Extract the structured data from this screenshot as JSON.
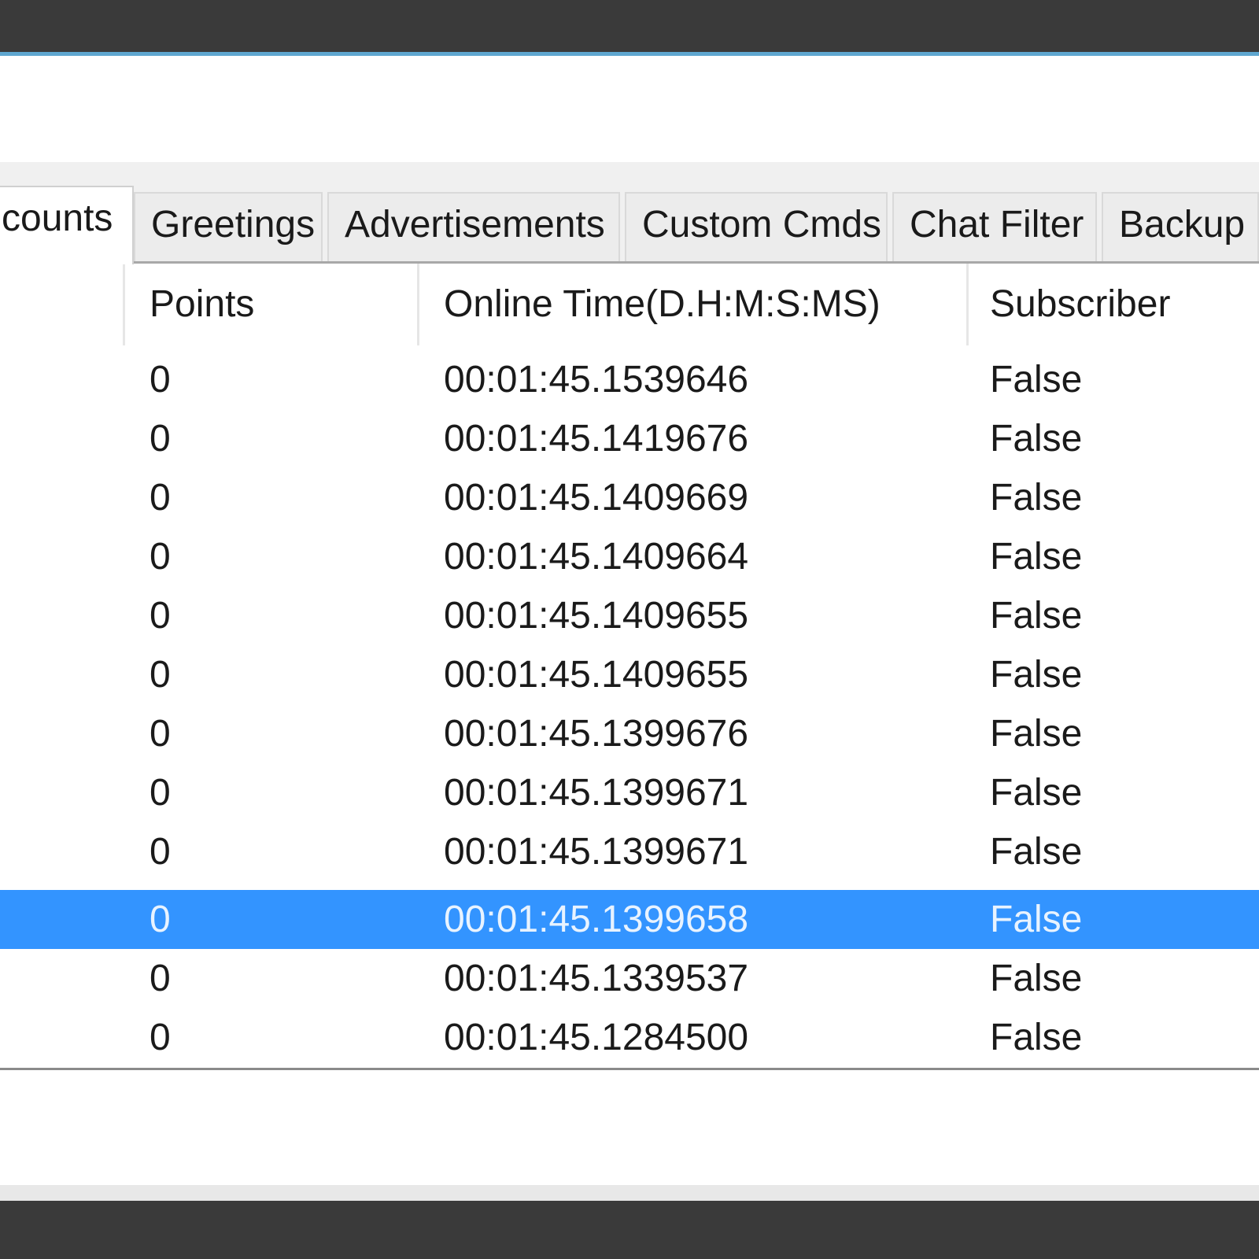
{
  "tabs": [
    {
      "label": "counts",
      "active": true
    },
    {
      "label": "Greetings",
      "active": false
    },
    {
      "label": "Advertisements",
      "active": false
    },
    {
      "label": "Custom Cmds",
      "active": false
    },
    {
      "label": "Chat Filter",
      "active": false
    },
    {
      "label": "Backup",
      "active": false
    }
  ],
  "table": {
    "columns": [
      "Points",
      "Online Time(D.H:M:S:MS)",
      "Subscriber"
    ],
    "rows": [
      {
        "points": "0",
        "online_time": "00:01:45.1539646",
        "subscriber": "False"
      },
      {
        "points": "0",
        "online_time": "00:01:45.1419676",
        "subscriber": "False"
      },
      {
        "points": "0",
        "online_time": "00:01:45.1409669",
        "subscriber": "False"
      },
      {
        "points": "0",
        "online_time": "00:01:45.1409664",
        "subscriber": "False"
      },
      {
        "points": "0",
        "online_time": "00:01:45.1409655",
        "subscriber": "False"
      },
      {
        "points": "0",
        "online_time": "00:01:45.1409655",
        "subscriber": "False"
      },
      {
        "points": "0",
        "online_time": "00:01:45.1399676",
        "subscriber": "False"
      },
      {
        "points": "0",
        "online_time": "00:01:45.1399671",
        "subscriber": "False"
      },
      {
        "points": "0",
        "online_time": "00:01:45.1399671",
        "subscriber": "False"
      },
      {
        "points": "0",
        "online_time": "00:01:45.1399658",
        "subscriber": "False",
        "selected": true
      },
      {
        "points": "0",
        "online_time": "00:01:45.1339537",
        "subscriber": "False"
      },
      {
        "points": "0",
        "online_time": "00:01:45.1284500",
        "subscriber": "False"
      }
    ]
  },
  "colors": {
    "selection": "#3394ff",
    "titlebar": "#3a3a3a",
    "accent": "#5fa7d0"
  }
}
